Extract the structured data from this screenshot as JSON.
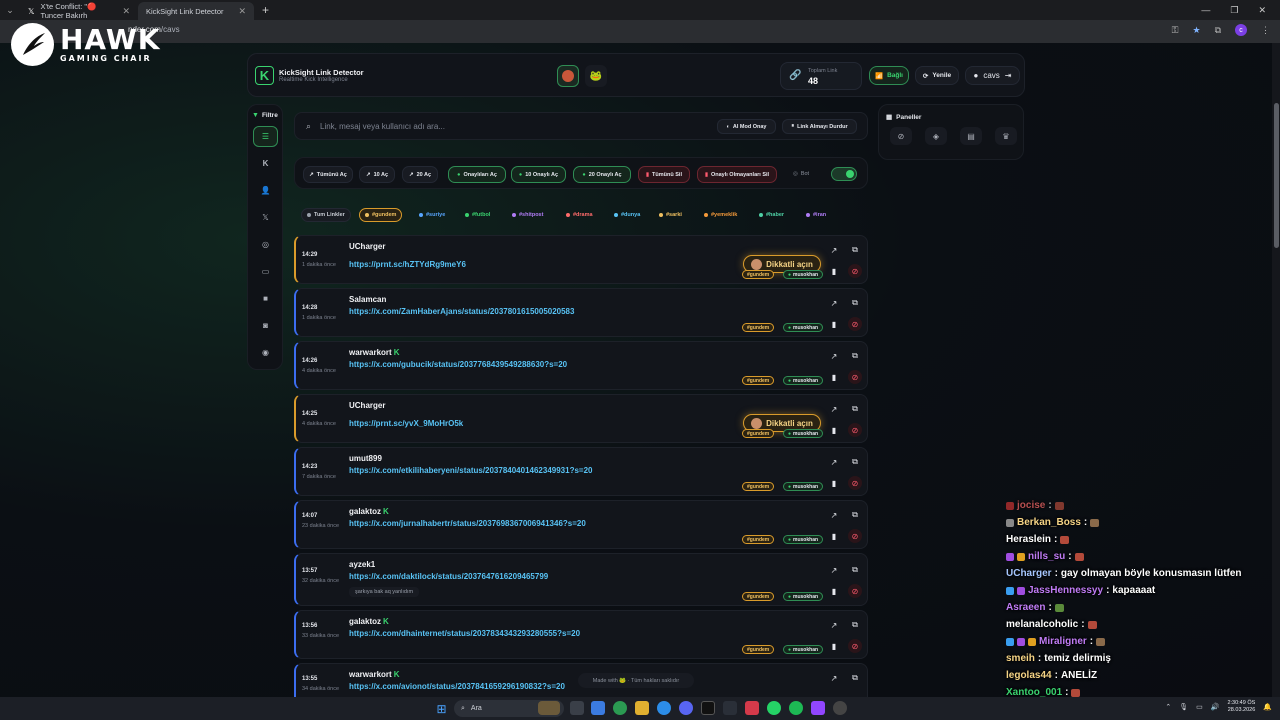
{
  "browser": {
    "tabs": [
      {
        "label": "X'te Conflict: \"🔴 Tuncer Bakırh",
        "icon": "x-logo-icon"
      },
      {
        "label": "KickSight Link Detector",
        "icon": "kick-icon"
      }
    ],
    "url_host": "nder.com",
    "url_path": "/cavs"
  },
  "watermark": {
    "title": "HAWK",
    "subtitle": "GAMING CHAIR"
  },
  "app": {
    "title": "KickSight Link Detector",
    "subtitle": "Realtime Kick Intelligence",
    "total_label": "Toplam Link",
    "total_value": "48",
    "connected_label": "Bağlı",
    "refresh_label": "Yenile",
    "username": "cavs"
  },
  "filter": {
    "title": "Filtre",
    "icons": [
      "list-icon",
      "kick-icon",
      "user-check-icon",
      "x-logo-icon",
      "instagram-icon",
      "youtube-icon",
      "video-icon",
      "camera-icon",
      "globe-icon"
    ]
  },
  "search": {
    "placeholder": "Link, mesaj veya kullanıcı adı ara...",
    "ai_mode_label": "AI Mod Onay",
    "stop_label": "Link Almayı Durdur"
  },
  "actions": {
    "open_all": "Tümünü Aç",
    "open_10": "10 Aç",
    "open_20": "20 Aç",
    "open_approved": "Onaylıları Aç",
    "open_10_approved": "10 Onaylı Aç",
    "open_20_approved": "20 Onaylı Aç",
    "delete_all": "Tümünü Sil",
    "delete_unapproved": "Onaylı Olmayanları Sil",
    "bot_label": "Bot"
  },
  "tags": [
    {
      "label": "Tum Linkler",
      "color": "#9aa0ab"
    },
    {
      "label": "#gundem",
      "color": "#f0c060"
    },
    {
      "label": "#suriye",
      "color": "#58a6ff"
    },
    {
      "label": "#futbol",
      "color": "#3ad36f"
    },
    {
      "label": "#shitpost",
      "color": "#b07cf5"
    },
    {
      "label": "#drama",
      "color": "#ff6b6b"
    },
    {
      "label": "#dunya",
      "color": "#58c3f5"
    },
    {
      "label": "#sarki",
      "color": "#f0c060"
    },
    {
      "label": "#yemeklik",
      "color": "#f59a3a"
    },
    {
      "label": "#haber",
      "color": "#4fd1a5"
    },
    {
      "label": "#iran",
      "color": "#b07cf5"
    }
  ],
  "panels": {
    "title": "Paneller"
  },
  "links": [
    {
      "time": "14:29",
      "ago": "1 dakika önce",
      "user": "UCharger",
      "kick": false,
      "url": "https://prnt.sc/hZTYdRg9meY6",
      "tag": "#gundem",
      "mod": "musokhan",
      "warn": true,
      "note": ""
    },
    {
      "time": "14:28",
      "ago": "1 dakika önce",
      "user": "Salamcan",
      "kick": false,
      "url": "https://x.com/ZamHaberAjans/status/2037801615005020583",
      "tag": "#gundem",
      "mod": "musokhan",
      "warn": false,
      "note": ""
    },
    {
      "time": "14:26",
      "ago": "4 dakika önce",
      "user": "warwarkort",
      "kick": true,
      "url": "https://x.com/gubucik/status/2037768439549288630?s=20",
      "tag": "#gundem",
      "mod": "musokhan",
      "warn": false,
      "note": ""
    },
    {
      "time": "14:25",
      "ago": "4 dakika önce",
      "user": "UCharger",
      "kick": false,
      "url": "https://prnt.sc/yvX_9MoHrO5k",
      "tag": "#gundem",
      "mod": "musokhan",
      "warn": true,
      "note": ""
    },
    {
      "time": "14:23",
      "ago": "7 dakika önce",
      "user": "umut899",
      "kick": false,
      "url": "https://x.com/etkilihaberyeni/status/2037840401462349931?s=20",
      "tag": "#gundem",
      "mod": "musokhan",
      "warn": false,
      "note": ""
    },
    {
      "time": "14:07",
      "ago": "23 dakika önce",
      "user": "galaktoz",
      "kick": true,
      "url": "https://x.com/jurnalhabertr/status/2037698367006941346?s=20",
      "tag": "#gundem",
      "mod": "musokhan",
      "warn": false,
      "note": ""
    },
    {
      "time": "13:57",
      "ago": "32 dakika önce",
      "user": "ayzek1",
      "kick": false,
      "url": "https://x.com/daktilock/status/2037647616209465799",
      "tag": "#gundem",
      "mod": "musokhan",
      "warn": false,
      "note": "şarkıya bak aq yanlıdım"
    },
    {
      "time": "13:56",
      "ago": "33 dakika önce",
      "user": "galaktoz",
      "kick": true,
      "url": "https://x.com/dhainternet/status/2037834343293280555?s=20",
      "tag": "#gundem",
      "mod": "musokhan",
      "warn": false,
      "note": ""
    },
    {
      "time": "13:55",
      "ago": "34 dakika önce",
      "user": "warwarkort",
      "kick": true,
      "url": "https://x.com/avionot/status/2037841659296190832?s=20",
      "tag": "#gundem",
      "mod": "musokhan",
      "warn": false,
      "note": ""
    }
  ],
  "warn_label": "Dikkatli açın",
  "footer": "Made with 🐸 · Tüm hakları saklıdır",
  "chat": [
    {
      "name": "jocise",
      "name_color": "#ff6b6b",
      "msg": ""
    },
    {
      "name": "Berkan_Boss",
      "name_color": "#f6d486",
      "msg": ""
    },
    {
      "name": "Heraslein",
      "name_color": "#ffffff",
      "msg": ""
    },
    {
      "name": "nills_su",
      "name_color": "#c07cf5",
      "msg": ""
    },
    {
      "name": "UCharger",
      "name_color": "#a7c7ff",
      "msg": "gay olmayan böyle konusmasın lütfen"
    },
    {
      "name": "JassHennessyy",
      "name_color": "#c07cf5",
      "msg": "kapaaaat"
    },
    {
      "name": "Asraeen",
      "name_color": "#c07cf5",
      "msg": ""
    },
    {
      "name": "melanalcoholic",
      "name_color": "#ffffff",
      "msg": ""
    },
    {
      "name": "Miraligner",
      "name_color": "#c07cf5",
      "msg": ""
    },
    {
      "name": "smeih",
      "name_color": "#f6d486",
      "msg": "temiz delirmiş"
    },
    {
      "name": "legolas44",
      "name_color": "#f6d486",
      "msg": "ANELİZ"
    },
    {
      "name": "Xantoo_001",
      "name_color": "#3ad36f",
      "msg": ""
    }
  ],
  "taskbar": {
    "search_label": "Ara",
    "time": "2:30:49 ÖS",
    "date": "28.03.2026"
  }
}
